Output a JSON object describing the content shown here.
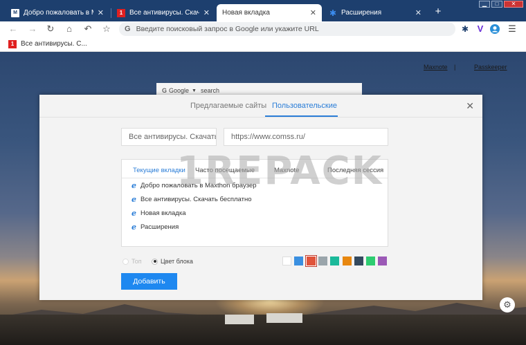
{
  "tabs": [
    {
      "title": "Добро пожаловать в Maxthon",
      "favicon": "maxthon-icon",
      "active": false
    },
    {
      "title": "Все антивирусы. Скачать бесплатно",
      "favicon": "comss-icon",
      "active": false
    },
    {
      "title": "Новая вкладка",
      "favicon": "",
      "active": true
    },
    {
      "title": "Расширения",
      "favicon": "puzzle-icon",
      "active": false
    }
  ],
  "tab_close_glyph": "✕",
  "new_tab_glyph": "+",
  "window_buttons": {
    "minimize": "▁",
    "maximize": "□",
    "close": "✕"
  },
  "toolbar": {
    "omnibox_prefix": "G",
    "omnibox_placeholder": "Введите поисковый запрос в Google или укажите URL"
  },
  "bookmarks": [
    {
      "title": "Все антивирусы. С..."
    }
  ],
  "page": {
    "link_maxnote": "Maxnote",
    "link_passkeeper": "Passkeeper",
    "link_sep": "|",
    "search_engine": "Google",
    "search_placeholder": "search"
  },
  "dialog": {
    "tab_suggested": "Предлагаемые сайты",
    "tab_custom": "Пользовательские",
    "name_value": "Все антивирусы. Скачать",
    "url_value": "https://www.comss.ru/",
    "list_tabs": [
      "Текущие вкладки",
      "Часто посещаемые",
      "Maxnote",
      "Последняя сессия"
    ],
    "list_items": [
      "Добро пожаловать в Maxthon браузер",
      "Все антивирусы. Скачать бесплатно",
      "Новая вкладка",
      "Расширения"
    ],
    "watermark": "1REPACK",
    "radio_top": "Топ",
    "radio_block_color": "Цвет блока",
    "add_button": "Добавить",
    "close_glyph": "✕"
  },
  "colors": {
    "chrome_bg": "#1d3f6e",
    "accent": "#2a7dd7",
    "button": "#1e88f0"
  },
  "swatches": [
    "#ffffff",
    "#3a8fe0",
    "#e0533a",
    "#9aa5ab",
    "#1bb99a",
    "#e8870f",
    "#34495e",
    "#2ecc71",
    "#9b59b6"
  ],
  "selected_swatch": 2,
  "icons": {
    "back": "arrow-left-icon",
    "forward": "arrow-right-icon",
    "reload": "reload-icon",
    "home": "home-icon",
    "undo": "undo-icon",
    "bookmark": "star-icon",
    "extensions": "puzzle-icon",
    "vpn": "v-icon",
    "profile": "avatar-icon",
    "menu": "hamburger-icon",
    "settings": "gear-icon"
  }
}
